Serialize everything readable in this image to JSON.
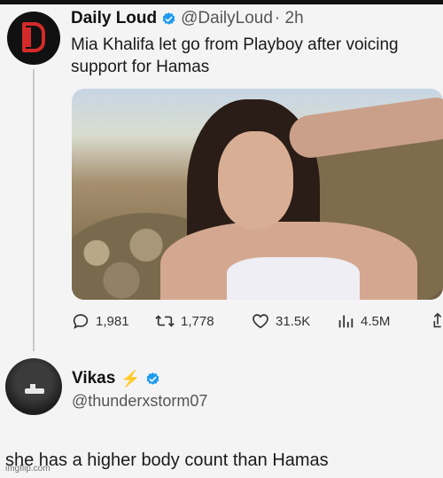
{
  "colors": {
    "verified_blue": "#1d9bf0",
    "lightning_gold": "#f0b429",
    "brand_red": "#d42a2a",
    "text_dark": "#1a1a1a",
    "text_muted": "#555555"
  },
  "tweet": {
    "author_name": "Daily Loud",
    "author_handle": "@DailyLoud",
    "time": "· 2h",
    "text": "Mia Khalifa let go from Playboy after voicing support for Hamas",
    "avatar_icon": "daily-loud-logo-icon",
    "verified_icon": "verified-badge-icon",
    "stats": {
      "replies": "1,981",
      "reposts": "1,778",
      "likes": "31.5K",
      "views": "4.5M"
    }
  },
  "reply": {
    "author_name": "Vikas",
    "author_emoji": "⚡",
    "author_handle": "@thunderxstorm07",
    "text": "she has a higher body count than Hamas"
  },
  "watermark": "imgflip.com"
}
